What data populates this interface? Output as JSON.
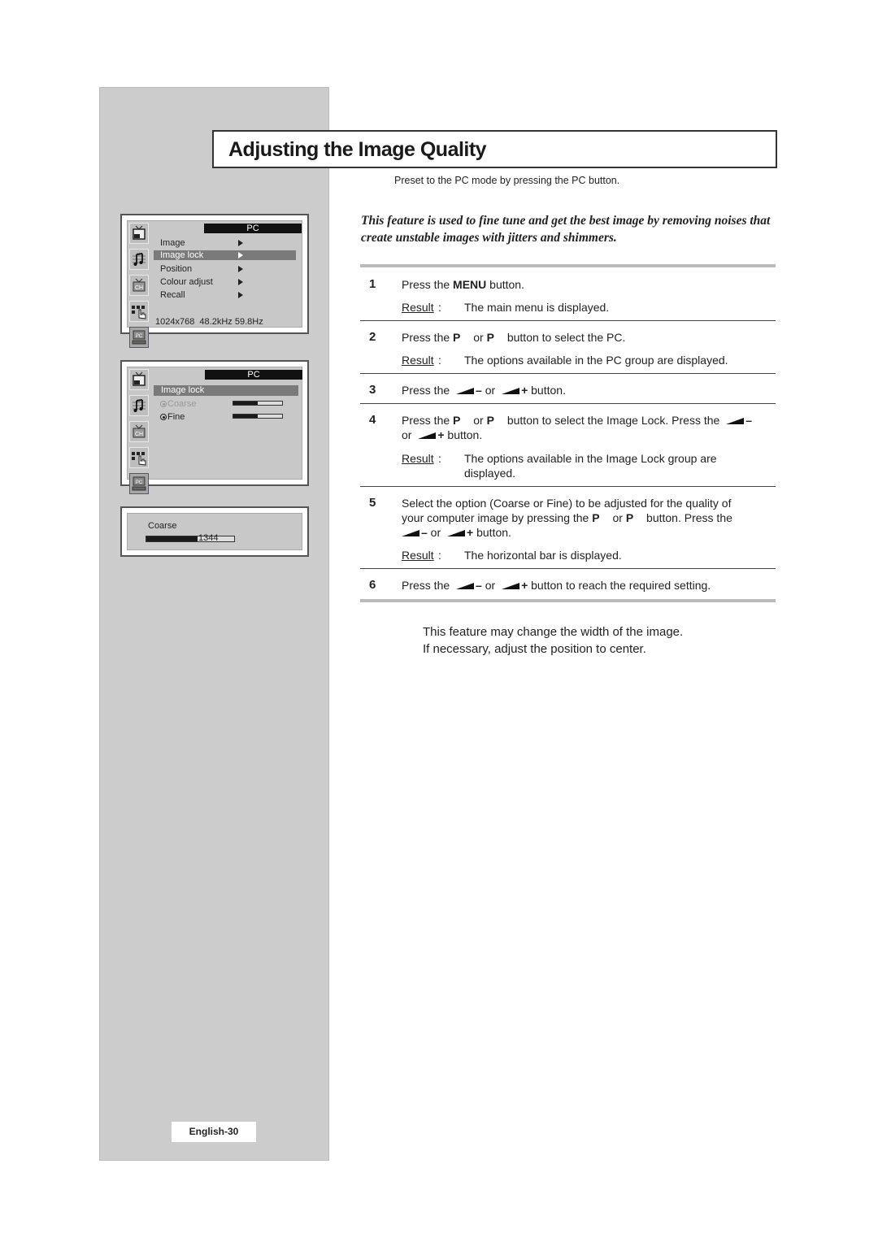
{
  "page": {
    "title": "Adjusting the Image Quality",
    "preset_note": "Preset to the PC mode by pressing the PC button.",
    "intro": "This feature is used to fine tune and get the best image by removing noises that create unstable images with jitters and shimmers.",
    "page_number": "English-30",
    "note_lines": [
      "This feature may change the width of the image.",
      "If necessary, adjust the position to center."
    ]
  },
  "result_label": "Result",
  "steps": [
    {
      "num": "1",
      "pre": "Press the ",
      "key": "MENU",
      "post": " button.",
      "result": "The main menu is displayed."
    },
    {
      "num": "2",
      "text_a": "Press the ",
      "key1": "P",
      "text_b": " or ",
      "key2": "P",
      "text_c": " button to select the PC.",
      "result": "The options available in the PC group are displayed."
    },
    {
      "num": "3",
      "text_a": "Press the ",
      "minus": "–",
      "or": " or ",
      "plus": "+",
      "text_b": " button."
    },
    {
      "num": "4",
      "text_a": "Press the ",
      "key1": "P",
      "text_b": " or ",
      "key2": "P",
      "text_c": " button to select the Image Lock. Press the ",
      "minus": "–",
      "or": "or ",
      "plus": "+",
      "text_d": " button.",
      "result": "The options available in the Image Lock group are displayed."
    },
    {
      "num": "5",
      "line1": "Select the option (Coarse or Fine) to be adjusted for the quality of",
      "line2a": "your computer image by pressing the ",
      "key1": "P",
      "line2b": " or ",
      "key2": "P",
      "line2c": " button. Press the",
      "minus": "–",
      "or": " or ",
      "plus": "+",
      "line3b": " button.",
      "result": "The horizontal bar is displayed."
    },
    {
      "num": "6",
      "text_a": "Press the ",
      "minus": "–",
      "or": " or ",
      "plus": "+",
      "text_b": " button to reach the required setting."
    }
  ],
  "osd_main": {
    "header": "PC",
    "items": [
      {
        "label": "Image"
      },
      {
        "label": "Image lock"
      },
      {
        "label": "Position"
      },
      {
        "label": "Colour adjust"
      },
      {
        "label": "Recall"
      }
    ],
    "selected": "Image lock",
    "status": "1024x768  48.2kHz 59.8Hz",
    "icons": [
      "picture-icon",
      "sound-icon",
      "channel-icon",
      "setup-icon",
      "pc-icon"
    ]
  },
  "osd_image_lock": {
    "header": "PC",
    "title": "Image lock",
    "options": [
      {
        "label": "Coarse",
        "level": 0.5
      },
      {
        "label": "Fine",
        "level": 0.5
      }
    ],
    "selected": "Fine"
  },
  "osd_coarse": {
    "label": "Coarse",
    "value": "1344",
    "level": 0.58
  }
}
